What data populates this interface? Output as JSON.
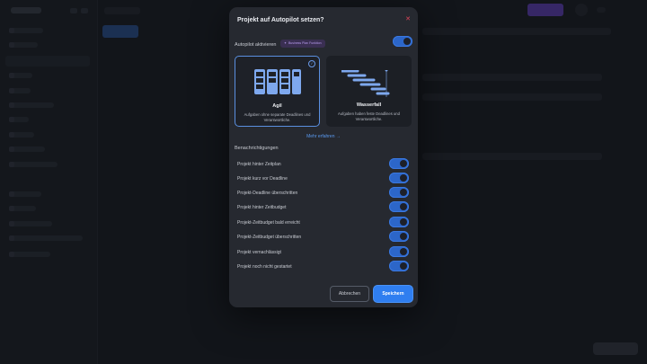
{
  "modal": {
    "title": "Projekt auf Autopilot setzen?",
    "close_icon": "close-icon",
    "autopilot": {
      "label": "Autopilot aktivieren",
      "badge": "Business Plan Funktion",
      "enabled": true
    },
    "cards": [
      {
        "title": "Agil",
        "desc": "Aufgaben ohne separate Deadlines und Verantwortliche.",
        "selected": true,
        "icon": "kanban-icon"
      },
      {
        "title": "Wasserfall",
        "desc": "Aufgaben haben feste Deadlines und Verantwortliche.",
        "selected": false,
        "icon": "gantt-icon"
      }
    ],
    "more_link": "Mehr erfahren",
    "section": "Benachrichtigungen",
    "notifications": [
      {
        "label": "Projekt hinter Zeitplan",
        "enabled": true
      },
      {
        "label": "Projekt kurz vor Deadline",
        "enabled": true
      },
      {
        "label": "Projekt-Deadline überschritten",
        "enabled": true
      },
      {
        "label": "Projekt hinter Zeitbudget",
        "enabled": true
      },
      {
        "label": "Projekt-Zeitbudget bald erreicht",
        "enabled": true
      },
      {
        "label": "Projekt-Zeitbudget überschritten",
        "enabled": true
      },
      {
        "label": "Projekt vernachlässigt",
        "enabled": true
      },
      {
        "label": "Projekt noch nicht gestartet",
        "enabled": true
      }
    ],
    "cancel_label": "Abbrechen",
    "save_label": "Speichern"
  },
  "colors": {
    "accent": "#2f7ef0",
    "toggle": "#2c66c9",
    "close": "#e0465a",
    "badge": "#b89cf0",
    "background": "#1b1e26",
    "modal": "#262930"
  }
}
